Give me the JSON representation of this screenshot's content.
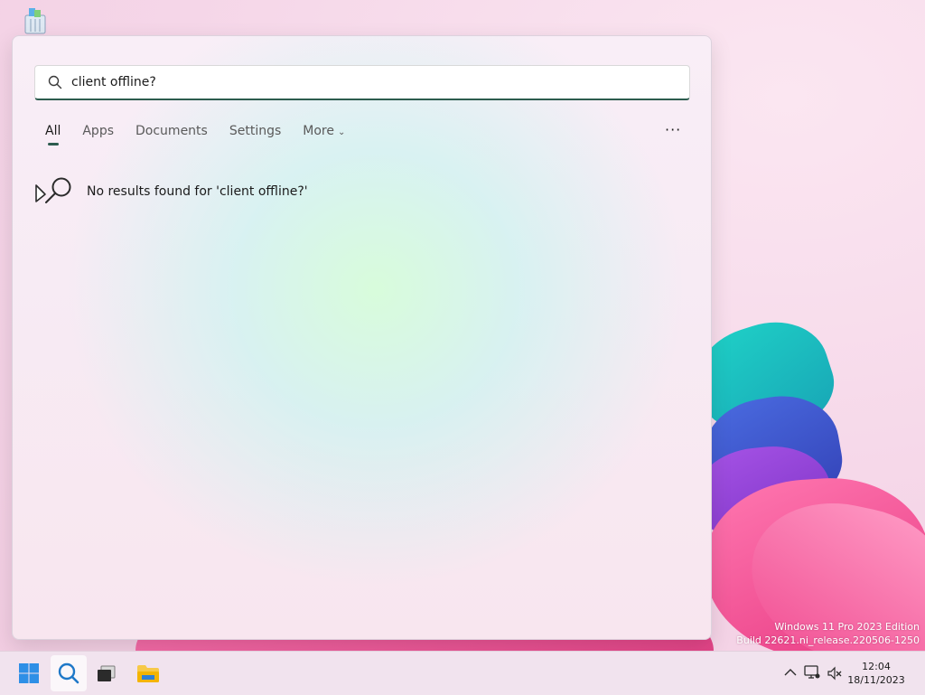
{
  "search": {
    "query": "client offline?",
    "no_results_text": "No results found for 'client offline?'"
  },
  "tabs": [
    {
      "label": "All",
      "active": true
    },
    {
      "label": "Apps"
    },
    {
      "label": "Documents"
    },
    {
      "label": "Settings"
    },
    {
      "label": "More"
    }
  ],
  "more_options_label": "···",
  "watermark": {
    "line1": "Windows 11 Pro 2023 Edition",
    "line2": "Build 22621.ni_release.220506-1250"
  },
  "clock": {
    "time": "12:04",
    "date": "18/11/2023"
  },
  "icons": {
    "start": "windows-logo-icon",
    "search": "search-icon",
    "task_view": "task-view-icon",
    "explorer": "folder-icon",
    "tray_overflow": "chevron-up-icon",
    "network": "network-icon",
    "volume": "volume-muted-icon"
  },
  "colors": {
    "accent": "#2c5c4e",
    "panel_background": "#f9eef7",
    "taskbar_background": "#f1e3ee"
  }
}
